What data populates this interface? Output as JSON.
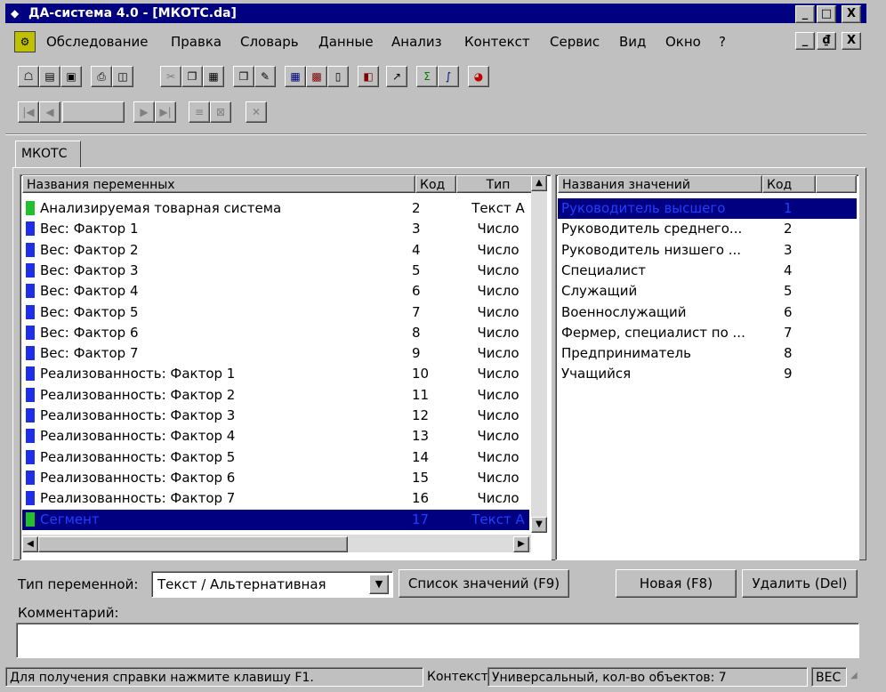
{
  "window": {
    "title": "ДА-система 4.0 - [МКОТС.da]",
    "minimize_label": "_",
    "restore_label": "□",
    "close_label": "X",
    "doc_restore_label": "₫"
  },
  "menu": {
    "items": [
      {
        "label": "Обследование"
      },
      {
        "label": "Правка"
      },
      {
        "label": "Словарь"
      },
      {
        "label": "Данные"
      },
      {
        "label": "Анализ"
      },
      {
        "label": "Контекст"
      },
      {
        "label": "Сервис"
      },
      {
        "label": "Вид"
      },
      {
        "label": "Окно"
      },
      {
        "label": "?"
      }
    ]
  },
  "tab": {
    "label": "МКОТС"
  },
  "variables": {
    "headers": {
      "name": "Названия переменных",
      "code": "Код",
      "type": "Тип"
    },
    "rows": [
      {
        "name": "Анализируемая товарная система",
        "code": "2",
        "type": "Текст А",
        "icon": "green"
      },
      {
        "name": "Вес: Фактор 1",
        "code": "3",
        "type": "Число",
        "icon": "blue"
      },
      {
        "name": "Вес: Фактор 2",
        "code": "4",
        "type": "Число",
        "icon": "blue"
      },
      {
        "name": "Вес: Фактор 3",
        "code": "5",
        "type": "Число",
        "icon": "blue"
      },
      {
        "name": "Вес: Фактор 4",
        "code": "6",
        "type": "Число",
        "icon": "blue"
      },
      {
        "name": "Вес: Фактор 5",
        "code": "7",
        "type": "Число",
        "icon": "blue"
      },
      {
        "name": "Вес: Фактор 6",
        "code": "8",
        "type": "Число",
        "icon": "blue"
      },
      {
        "name": "Вес: Фактор 7",
        "code": "9",
        "type": "Число",
        "icon": "blue"
      },
      {
        "name": "Реализованность: Фактор 1",
        "code": "10",
        "type": "Число",
        "icon": "blue"
      },
      {
        "name": "Реализованность: Фактор 2",
        "code": "11",
        "type": "Число",
        "icon": "blue"
      },
      {
        "name": "Реализованность: Фактор 3",
        "code": "12",
        "type": "Число",
        "icon": "blue"
      },
      {
        "name": "Реализованность: Фактор 4",
        "code": "13",
        "type": "Число",
        "icon": "blue"
      },
      {
        "name": "Реализованность: Фактор 5",
        "code": "14",
        "type": "Число",
        "icon": "blue"
      },
      {
        "name": "Реализованность: Фактор 6",
        "code": "15",
        "type": "Число",
        "icon": "blue"
      },
      {
        "name": "Реализованность: Фактор 7",
        "code": "16",
        "type": "Число",
        "icon": "blue"
      },
      {
        "name": "Сегмент",
        "code": "17",
        "type": "Текст А",
        "icon": "green",
        "selected": true
      }
    ]
  },
  "values": {
    "headers": {
      "name": "Названия значений",
      "code": "Код"
    },
    "rows": [
      {
        "name": "Руководитель высшего",
        "code": "1",
        "selected": true
      },
      {
        "name": "Руководитель среднего...",
        "code": "2"
      },
      {
        "name": "Руководитель низшего ...",
        "code": "3"
      },
      {
        "name": "Специалист",
        "code": "4"
      },
      {
        "name": "Служащий",
        "code": "5"
      },
      {
        "name": "Военнослужащий",
        "code": "6"
      },
      {
        "name": "Фермер, специалист по ...",
        "code": "7"
      },
      {
        "name": "Предприниматель",
        "code": "8"
      },
      {
        "name": "Учащийся",
        "code": "9"
      }
    ]
  },
  "form": {
    "var_type_label": "Тип переменной:",
    "var_type_value": "Текст / Альтернативная",
    "values_list_button": "Список значений (F9)",
    "new_button": "Новая (F8)",
    "delete_button": "Удалить (Del)",
    "comment_label": "Комментарий:",
    "comment_value": ""
  },
  "status": {
    "help": "Для получения справки нажмите клавишу F1.",
    "context_label": "Контекст",
    "context_value": "Универсальный, кол-во объектов: 7",
    "mode": "ВЕС"
  },
  "colors": {
    "title_bg": "#000080",
    "selection_bg": "#000080",
    "selection_text": "#1e40ff",
    "icon_green": "#22c02a",
    "icon_blue": "#1f2ee8"
  }
}
